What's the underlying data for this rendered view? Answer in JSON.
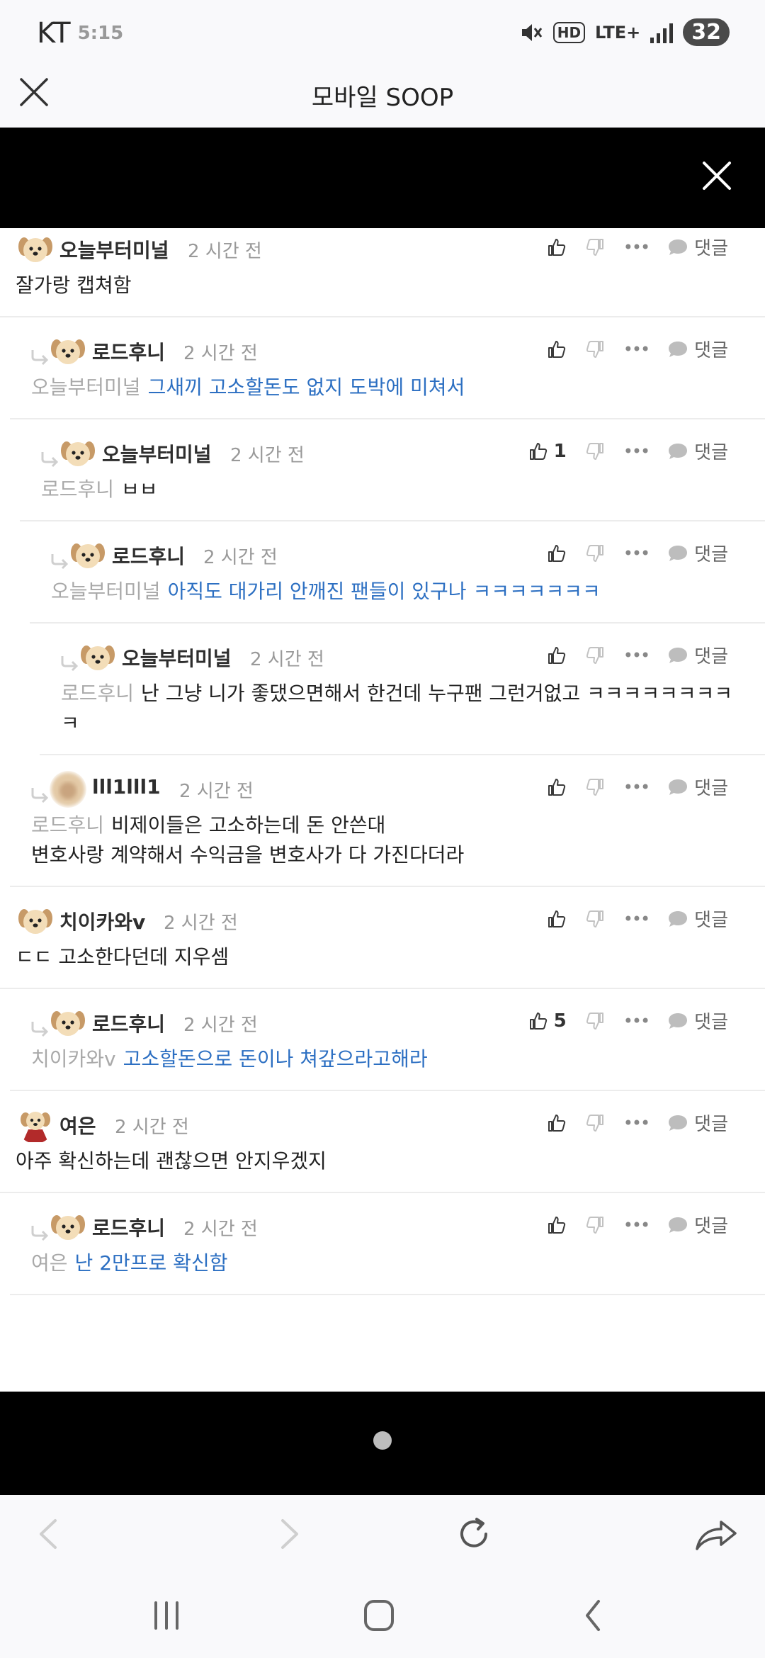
{
  "status_bar": {
    "carrier": "KT",
    "time": "5:15",
    "hd": "HD",
    "network": "LTE+",
    "battery": "32"
  },
  "header": {
    "title": "모바일 SOOP"
  },
  "actions": {
    "reply_label": "댓글"
  },
  "comments": [
    {
      "depth": 0,
      "nick": "오늘부터미널",
      "time": "2 시간 전",
      "likes": "",
      "mention": "",
      "text": "잘가랑 캡쳐함",
      "highlight": false,
      "avatar": "puppy-avatar"
    },
    {
      "depth": 1,
      "nick": "로드후니",
      "time": "2 시간 전",
      "likes": "",
      "mention": "오늘부터미널",
      "text": "그새끼 고소할돈도 없지 도박에 미쳐서",
      "highlight": true,
      "avatar": "puppy-avatar"
    },
    {
      "depth": 2,
      "nick": "오늘부터미널",
      "time": "2 시간 전",
      "likes": "1",
      "mention": "로드후니",
      "text": "ㅂㅂ",
      "highlight": false,
      "avatar": "puppy-avatar"
    },
    {
      "depth": 3,
      "nick": "로드후니",
      "time": "2 시간 전",
      "likes": "",
      "mention": "오늘부터미널",
      "text": "아직도 대가리 안깨진 팬들이 있구나 ㅋㅋㅋㅋㅋㅋㅋ",
      "highlight": true,
      "avatar": "puppy-avatar"
    },
    {
      "depth": 4,
      "nick": "오늘부터미널",
      "time": "2 시간 전",
      "likes": "",
      "mention": "로드후니",
      "text": "난 그냥 니가 좋댔으면해서 한건데 누구팬 그런거없고 ㅋㅋㅋㅋㅋㅋㅋㅋㅋ",
      "highlight": false,
      "avatar": "puppy-avatar"
    },
    {
      "depth": 1,
      "nick": "lll1lll1",
      "time": "2 시간 전",
      "likes": "",
      "mention": "로드후니",
      "text": "비제이들은 고소하는데 돈 안쓴대\n변호사랑 계약해서 수익금을 변호사가 다 가진다더라",
      "highlight": false,
      "avatar": "blurred-avatar"
    },
    {
      "depth": 0,
      "nick": "치이카와v",
      "time": "2 시간 전",
      "likes": "",
      "mention": "",
      "text": "ㄷㄷ 고소한다던데 지우셈",
      "highlight": false,
      "avatar": "puppy-avatar"
    },
    {
      "depth": 1,
      "nick": "로드후니",
      "time": "2 시간 전",
      "likes": "5",
      "mention": "치이카와v",
      "text": "고소할돈으로 돈이나 쳐갚으라고해라",
      "highlight": true,
      "avatar": "puppy-avatar"
    },
    {
      "depth": 0,
      "nick": "여은",
      "time": "2 시간 전",
      "likes": "",
      "mention": "",
      "text": "아주 확신하는데 괜찮으면 안지우겠지",
      "highlight": false,
      "avatar": "caped-puppy-avatar"
    },
    {
      "depth": 1,
      "nick": "로드후니",
      "time": "2 시간 전",
      "likes": "",
      "mention": "여은",
      "text": "난 2만프로 확신함",
      "highlight": true,
      "avatar": "puppy-avatar"
    }
  ],
  "colors": {
    "highlight_text": "#2c6fc2",
    "mention_text": "#a9a9a9",
    "time_text": "#999999",
    "ad_background": "#000000"
  }
}
